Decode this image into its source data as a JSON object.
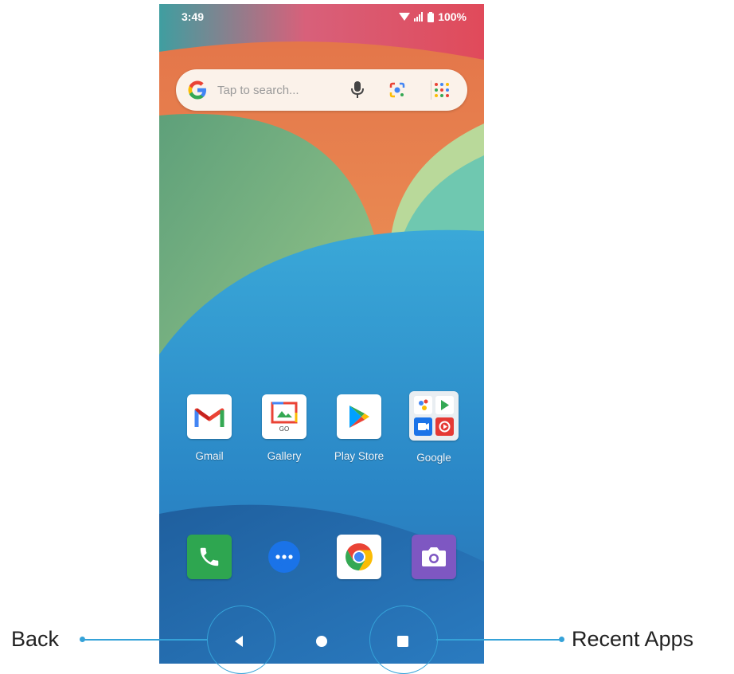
{
  "status_bar": {
    "time": "3:49",
    "battery": "100%"
  },
  "search": {
    "placeholder": "Tap to search..."
  },
  "home_apps": [
    {
      "label": "Gmail"
    },
    {
      "label": "Gallery",
      "sub": "GO"
    },
    {
      "label": "Play Store"
    },
    {
      "label": "Google"
    }
  ],
  "dock": [
    "phone-icon",
    "messages-icon",
    "chrome-icon",
    "camera-icon"
  ],
  "callouts": {
    "back": "Back",
    "recent": "Recent Apps"
  },
  "colors": {
    "callout": "#35a2d8",
    "wall_orange": "#f0924a",
    "wall_blue": "#2a84c4",
    "wall_teal": "#6fc8b0"
  }
}
